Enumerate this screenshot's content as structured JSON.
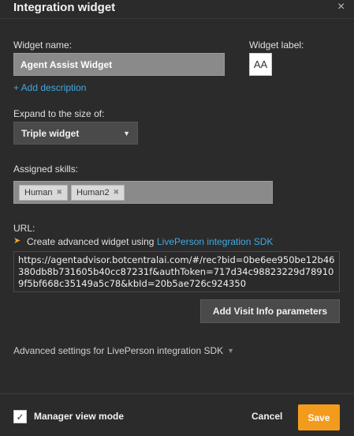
{
  "header": {
    "title": "Integration widget",
    "close_icon": "×"
  },
  "widget_name": {
    "label": "Widget name:",
    "value": "Agent Assist Widget"
  },
  "add_description": "+ Add description",
  "widget_label": {
    "label": "Widget label:",
    "value": "AA"
  },
  "expand": {
    "label": "Expand to the size of:",
    "selected": "Triple widget",
    "chevron_icon": "chevron-down-icon"
  },
  "skills": {
    "label": "Assigned skills:",
    "items": [
      "Human",
      "Human2"
    ]
  },
  "url": {
    "label": "URL:",
    "create_text": "Create advanced widget using",
    "sdk_link": "LivePerson integration SDK",
    "value": "https://agentadvisor.botcentralai.com/#/rec?bid=0be6ee950be12b46380db8b731605b40cc87231f&authToken=717d34c98823229d789109f5bf668c35149a5c78&kbId=20b5ae726c924350"
  },
  "visit_button": "Add Visit Info parameters",
  "advanced": "Advanced settings for LivePerson integration SDK",
  "footer": {
    "manager_view": "Manager view mode",
    "manager_checked": true,
    "cancel": "Cancel",
    "save": "Save"
  },
  "colors": {
    "accent": "#41a9e0",
    "save": "#f39b1c",
    "arrow": "#f5a623"
  }
}
